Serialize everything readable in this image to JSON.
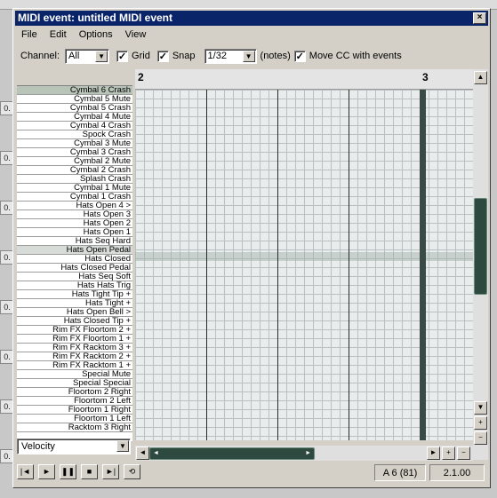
{
  "window": {
    "title": "MIDI event: untitled MIDI event",
    "close_glyph": "×"
  },
  "menu": [
    "File",
    "Edit",
    "Options",
    "View"
  ],
  "toolbar": {
    "channel_label": "Channel:",
    "channel_value": "All",
    "grid_label": "Grid",
    "grid_checked": "✓",
    "snap_label": "Snap",
    "snap_checked": "✓",
    "division_value": "1/32",
    "notes_label": "(notes)",
    "movecc_label": "Move CC with events",
    "movecc_checked": "✓"
  },
  "ruler": {
    "bar_start": "2",
    "bar_next": "3"
  },
  "keys": [
    "Cymbal 6 Crash",
    "Cymbal 5 Mute",
    "Cymbal 5 Crash",
    "Cymbal 4 Mute",
    "Cymbal 4 Crash",
    "Spock Crash",
    "Cymbal 3 Mute",
    "Cymbal 3 Crash",
    "Cymbal 2 Mute",
    "Cymbal 2 Crash",
    "Splash Crash",
    "Cymbal 1 Mute",
    "Cymbal 1 Crash",
    "Hats Open 4 >",
    "Hats Open 3",
    "Hats Open 2",
    "Hats Open 1",
    "Hats Seq Hard",
    "Hats Open Pedal",
    "Hats Closed",
    "Hats Closed Pedal",
    "Hats Seq Soft",
    "Hats Hats Trig",
    "Hats Tight Tip +",
    "Hats Tight +",
    "Hats Open Bell >",
    "Hats Closed Tip +",
    "Rim FX Floortom 2 +",
    "Rim FX Floortom 1 +",
    "Rim FX Racktom 3 +",
    "Rim FX Racktom 2 +",
    "Rim FX Racktom 1 +",
    "Special Mute",
    "Special Special",
    "Floortom 2 Right",
    "Floortom 2 Left",
    "Floortom 1 Right",
    "Floortom 1 Left",
    "Racktom 3 Right"
  ],
  "velocity_lane": "Velocity",
  "status": {
    "note": "A 6 (81)",
    "position": "2.1.00"
  },
  "bg_tracks": [
    "0.",
    "0.",
    "0.",
    "0.",
    "0.",
    "0.",
    "0.",
    "0."
  ],
  "icons": {
    "scroll_up": "▲",
    "scroll_down": "▼",
    "scroll_left": "◄",
    "scroll_right": "►",
    "zoom_in": "+",
    "zoom_out": "−",
    "combo_arrow": "▼",
    "transport": [
      "|◄",
      "►",
      "❚❚",
      "■",
      "►|",
      "⟲"
    ]
  }
}
